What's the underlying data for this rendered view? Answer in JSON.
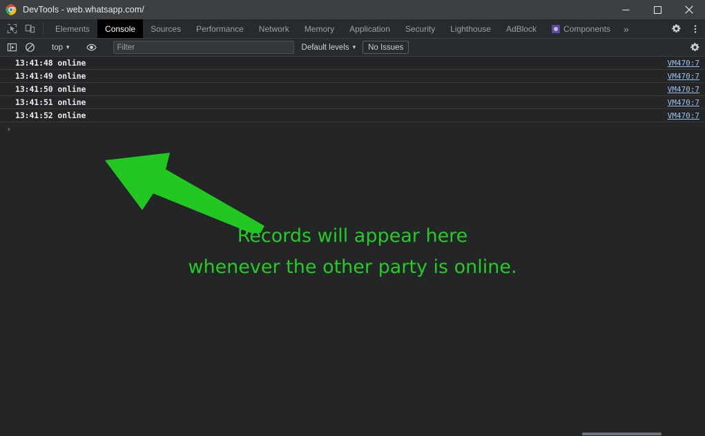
{
  "window": {
    "title": "DevTools - web.whatsapp.com/",
    "app_icon": "chrome-logo-icon",
    "controls": {
      "minimize": "minimize-icon",
      "maximize": "maximize-icon",
      "close": "close-icon"
    }
  },
  "devtools": {
    "left_icons": [
      {
        "name": "inspect-element-icon"
      },
      {
        "name": "device-toolbar-icon"
      }
    ],
    "tabs": [
      {
        "label": "Elements",
        "selected": false,
        "icon": null
      },
      {
        "label": "Console",
        "selected": true,
        "icon": null
      },
      {
        "label": "Sources",
        "selected": false,
        "icon": null
      },
      {
        "label": "Performance",
        "selected": false,
        "icon": null
      },
      {
        "label": "Network",
        "selected": false,
        "icon": null
      },
      {
        "label": "Memory",
        "selected": false,
        "icon": null
      },
      {
        "label": "Application",
        "selected": false,
        "icon": null
      },
      {
        "label": "Security",
        "selected": false,
        "icon": null
      },
      {
        "label": "Lighthouse",
        "selected": false,
        "icon": null
      },
      {
        "label": "AdBlock",
        "selected": false,
        "icon": null
      },
      {
        "label": "Components",
        "selected": false,
        "icon": "react-components-icon"
      }
    ],
    "more_tabs_label": "»",
    "settings_icon": "gear-icon",
    "more_options_icon": "kebab-menu-icon"
  },
  "console_toolbar": {
    "sidebar_toggle_icon": "console-sidebar-icon",
    "clear_console_icon": "clear-console-icon",
    "context_selector": {
      "value": "top",
      "caret": "▾"
    },
    "eye_icon": "live-expression-eye-icon",
    "filter": {
      "value": "",
      "placeholder": "Filter"
    },
    "levels_selector": {
      "value": "Default levels",
      "caret": "▾"
    },
    "issues_button": "No Issues",
    "settings_icon": "console-settings-gear-icon"
  },
  "console_log": {
    "rows": [
      {
        "message": "13:41:48 online",
        "source": "VM470:7"
      },
      {
        "message": "13:41:49 online",
        "source": "VM470:7"
      },
      {
        "message": "13:41:50 online",
        "source": "VM470:7"
      },
      {
        "message": "13:41:51 online",
        "source": "VM470:7"
      },
      {
        "message": "13:41:52 online",
        "source": "VM470:7"
      }
    ],
    "prompt_chevron": "›"
  },
  "annotations": {
    "arrow_color": "#22c722",
    "text_color": "#25cc25",
    "callout_text": "Records will appear here\nwhenever the other party is online."
  },
  "colors": {
    "titlebar_bg": "#3c4043",
    "toolbar_bg": "#282b2e",
    "console_bg": "#242526",
    "selected_tab_bg": "#000000",
    "link_blue": "#9cc2f0",
    "prompt_blue": "#5b8ddb",
    "annotation_green": "#22c722"
  }
}
